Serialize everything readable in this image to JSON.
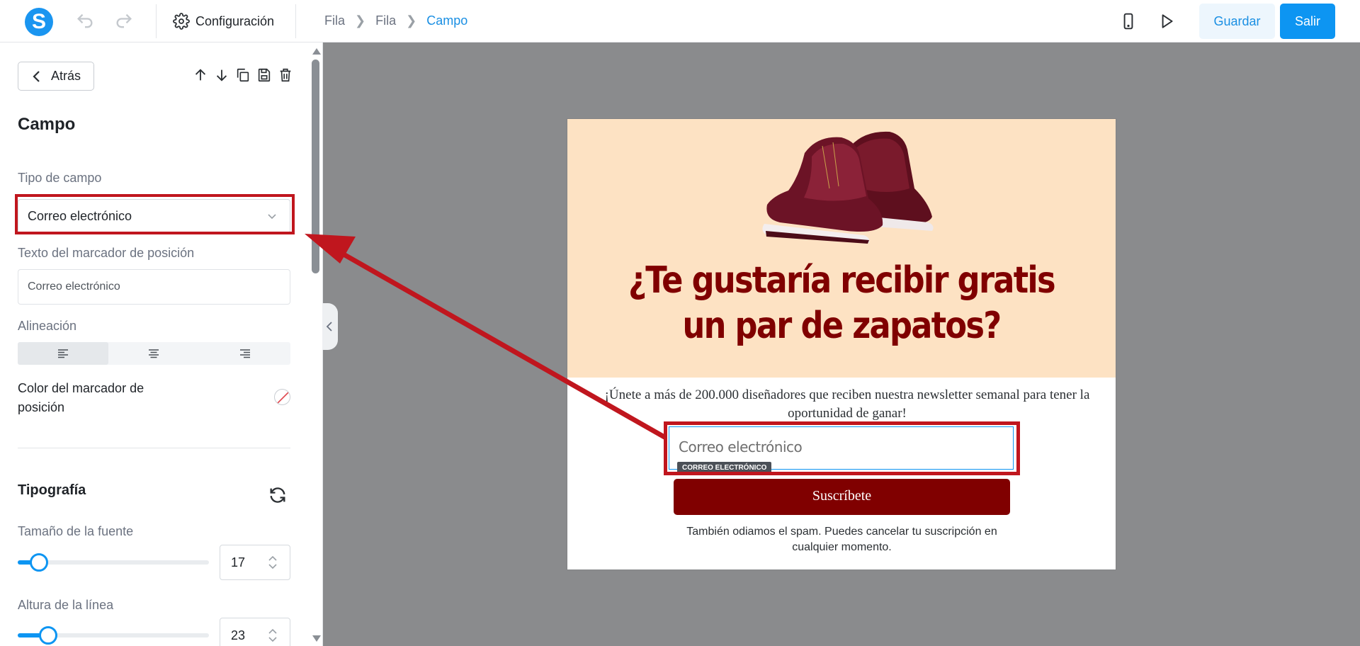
{
  "header": {
    "logo_letter": "S",
    "config_label": "Configuración",
    "breadcrumb": [
      "Fila",
      "Fila",
      "Campo"
    ],
    "guardar_label": "Guardar",
    "salir_label": "Salir"
  },
  "panel": {
    "back_label": "Atrás",
    "title": "Campo",
    "field_type_label": "Tipo de campo",
    "field_type_value": "Correo electrónico",
    "placeholder_label": "Texto del marcador de posición",
    "placeholder_value": "Correo electrónico",
    "alignment_label": "Alineación",
    "alignment_selected": "left",
    "placeholder_color_label": "Color del marcador de posición",
    "typography_title": "Tipografía",
    "font_size_label": "Tamaño de la fuente",
    "font_size_value": "17",
    "font_size_slider": 0.11,
    "line_height_label": "Altura de la línea",
    "line_height_value": "23",
    "line_height_slider": 0.16
  },
  "popup": {
    "headline": "¿Te gustaría recibir gratis un par de zapatos?",
    "subtext": "¡Únete a más de 200.000 diseñadores que reciben nuestra newsletter semanal para tener la oportunidad de ganar!",
    "email_placeholder": "Correo electrónico",
    "field_tag": "CORREO ELECTRÓNICO",
    "button_label": "Suscríbete",
    "fineprint": "También odiamos el spam. Puedes cancelar tu suscripción en cualquier momento."
  },
  "colors": {
    "accent": "#0d95f2",
    "brand_maroon": "#800000",
    "hero_bg": "#fde2c3",
    "highlight": "#c0161e",
    "canvas_bg": "#8a8b8d"
  }
}
